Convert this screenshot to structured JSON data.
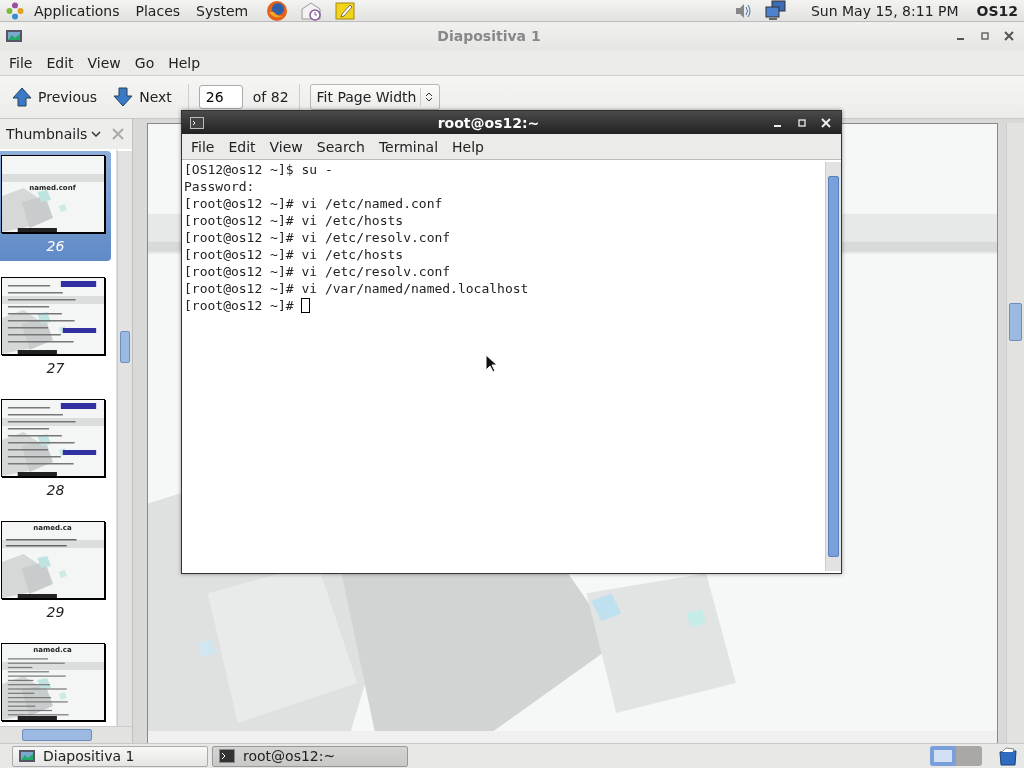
{
  "top_panel": {
    "menus": [
      "Applications",
      "Places",
      "System"
    ],
    "clock": "Sun May 15,  8:11 PM",
    "user": "OS12"
  },
  "viewer": {
    "title": "Diapositiva 1",
    "menus": [
      "File",
      "Edit",
      "View",
      "Go",
      "Help"
    ],
    "toolbar": {
      "previous": "Previous",
      "next": "Next",
      "page": "26",
      "page_count": "of 82",
      "zoom": "Fit Page Width"
    },
    "sidebar": {
      "title": "Thumbnails",
      "thumbnails": [
        {
          "number": "26",
          "kind": "title",
          "title": "named.conf",
          "selected": true
        },
        {
          "number": "27",
          "kind": "text",
          "selected": false
        },
        {
          "number": "28",
          "kind": "text",
          "selected": false
        },
        {
          "number": "29",
          "kind": "bullets",
          "title": "named.ca",
          "selected": false
        },
        {
          "kind": "list",
          "title": "named.ca",
          "selected": false
        }
      ]
    }
  },
  "terminal": {
    "title": "root@os12:~",
    "menus": [
      "File",
      "Edit",
      "View",
      "Search",
      "Terminal",
      "Help"
    ],
    "lines": [
      "[OS12@os12 ~]$ su -",
      "Password:",
      "[root@os12 ~]# vi /etc/named.conf",
      "[root@os12 ~]# vi /etc/hosts",
      "[root@os12 ~]# vi /etc/resolv.conf",
      "[root@os12 ~]# vi /etc/hosts",
      "[root@os12 ~]# vi /etc/resolv.conf",
      "[root@os12 ~]# vi /var/named/named.localhost"
    ],
    "prompt": "[root@os12 ~]# "
  },
  "taskbar": {
    "tasks": [
      {
        "label": "Diapositiva 1",
        "kind": "viewer",
        "selected": false
      },
      {
        "label": "root@os12:~",
        "kind": "terminal",
        "selected": true
      }
    ],
    "workspaces": [
      {
        "selected": true
      },
      {
        "selected": false
      }
    ]
  }
}
